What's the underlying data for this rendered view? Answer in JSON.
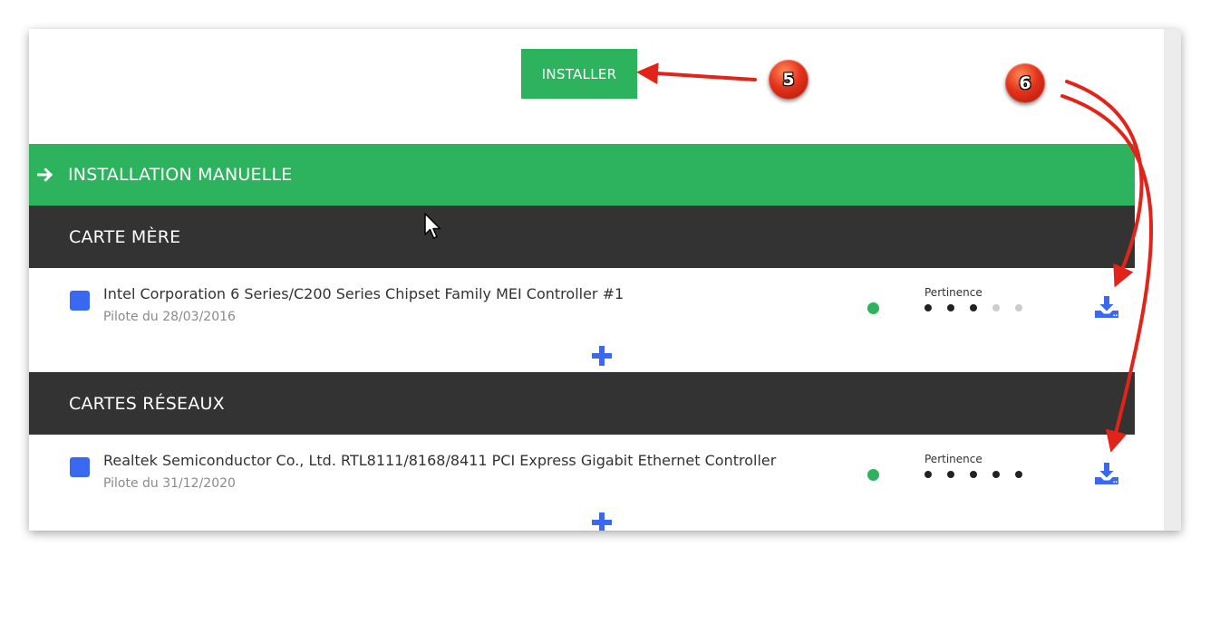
{
  "install_button": {
    "label": "INSTALLER"
  },
  "manual_section": {
    "title": "INSTALLATION MANUELLE",
    "icon": "arrow-right-icon"
  },
  "categories": [
    {
      "title": "CARTE MÈRE",
      "devices": [
        {
          "name": "Intel Corporation 6 Series/C200 Series Chipset Family MEI Controller #1",
          "date": "Pilote du 28/03/2016",
          "relevance_label": "Pertinence",
          "relevance": 3,
          "relevance_max": 5
        }
      ]
    },
    {
      "title": "CARTES RÉSEAUX",
      "devices": [
        {
          "name": "Realtek Semiconductor Co., Ltd. RTL8111/8168/8411 PCI Express Gigabit Ethernet Controller",
          "date": "Pilote du 31/12/2020",
          "relevance_label": "Pertinence",
          "relevance": 5,
          "relevance_max": 5
        }
      ]
    }
  ],
  "annotations": [
    {
      "label": "5"
    },
    {
      "label": "6"
    }
  ],
  "colors": {
    "green": "#2db35d",
    "dark": "#333333",
    "blue": "#3b68f0",
    "dot_on": "#222222",
    "dot_off": "#cccccc",
    "annotation_red": "#e2231a"
  }
}
